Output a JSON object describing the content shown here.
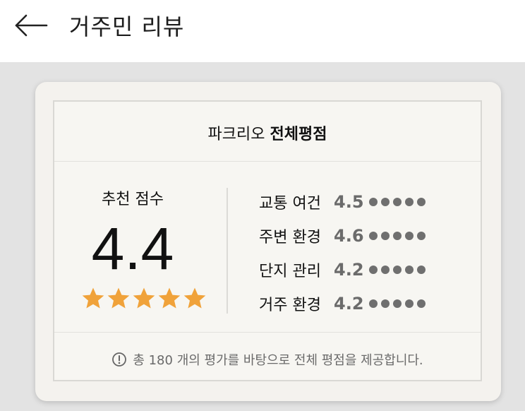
{
  "header": {
    "back_icon": "arrow-left-icon",
    "title": "거주민 리뷰"
  },
  "card": {
    "title_prefix": "파크리오",
    "title_strong": "전체평점",
    "recommend_label": "추천 점수",
    "recommend_score": "4.4",
    "star_rating": 4.4,
    "star_count": 5,
    "star_color": "#f0a23a",
    "ratings": [
      {
        "label": "교통 여건",
        "value": "4.5"
      },
      {
        "label": "주변 환경",
        "value": "4.6"
      },
      {
        "label": "단지 관리",
        "value": "4.2"
      },
      {
        "label": "거주 환경",
        "value": "4.2"
      }
    ],
    "footer_icon": "info-circle-icon",
    "footer_text": "총 180 개의 평가를 바탕으로 전체 평점을 제공합니다."
  }
}
